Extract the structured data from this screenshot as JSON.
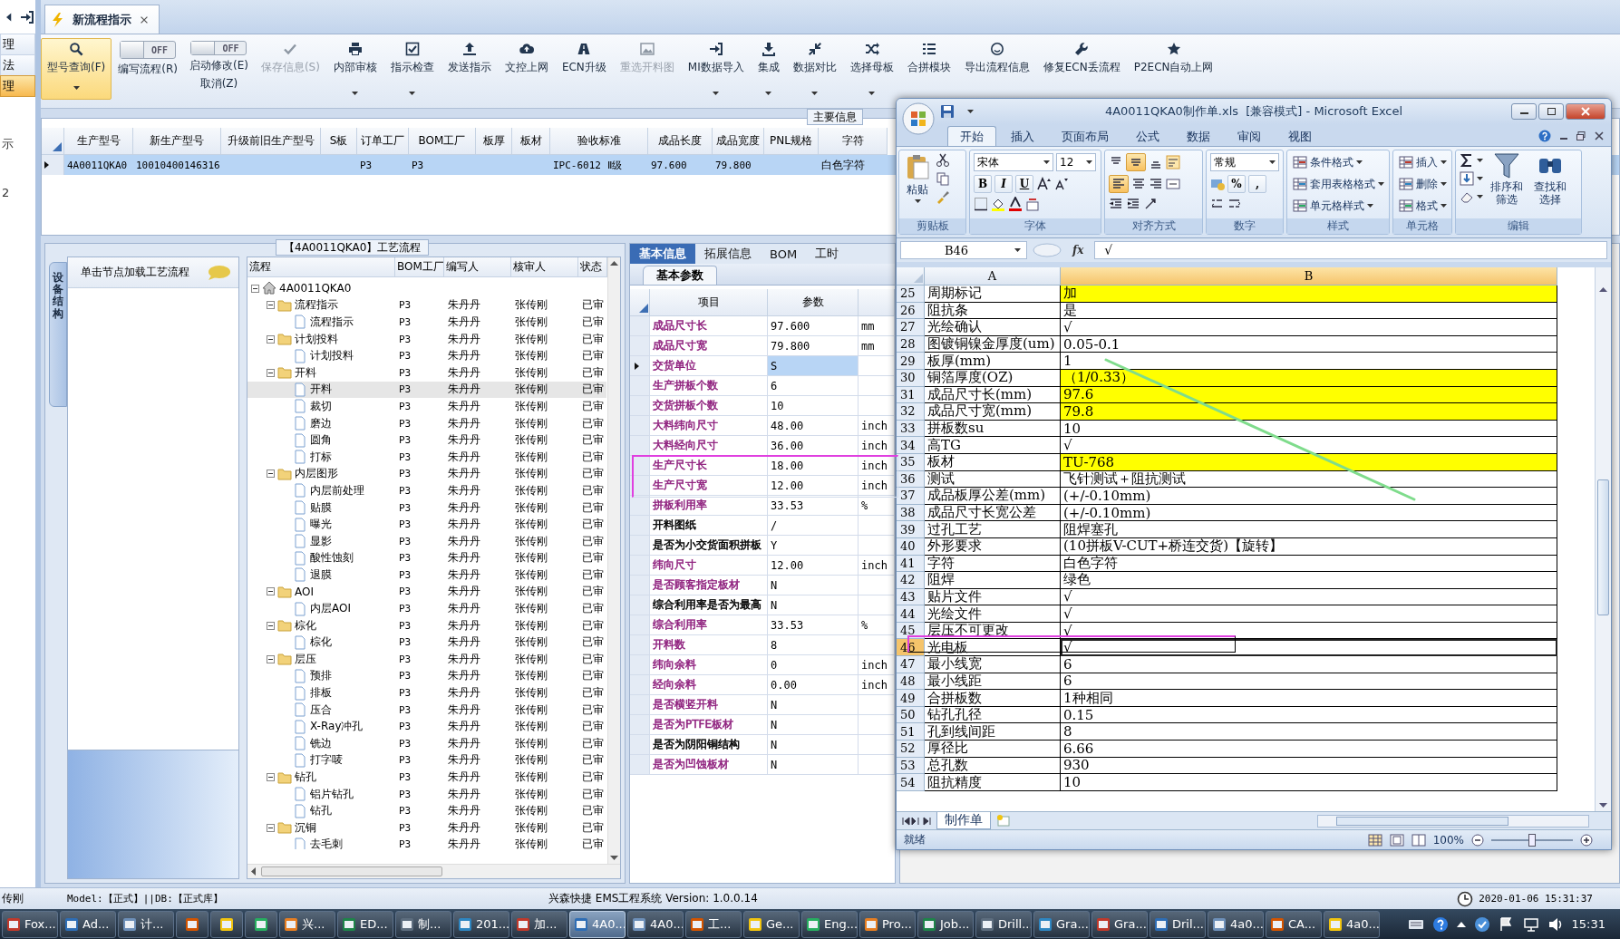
{
  "nav": {
    "items": [
      {
        "label": "理",
        "selected": false
      },
      {
        "label": "法",
        "selected": false
      },
      {
        "label": "理",
        "selected": true
      }
    ],
    "notes": [
      "示",
      "2"
    ]
  },
  "doc_tabs": [
    {
      "label": "新流程指示",
      "selected": true
    }
  ],
  "toolbar": {
    "items": [
      {
        "kind": "button",
        "label": "型号查询(F)",
        "active": true,
        "dropdown": true,
        "disabled": false
      },
      {
        "kind": "toggle",
        "label": "编写流程(R)",
        "switch_text": "OFF",
        "on": false
      },
      {
        "kind": "toggle",
        "label": "启动修改(E)",
        "sublabel": "取消(Z)",
        "switch_text": "OFF",
        "on": false
      },
      {
        "kind": "button",
        "label": "保存信息(S)",
        "active": false,
        "dropdown": false,
        "disabled": true
      },
      {
        "kind": "button",
        "label": "内部审核",
        "active": false,
        "dropdown": true,
        "disabled": false
      },
      {
        "kind": "button",
        "label": "指示检查",
        "active": false,
        "dropdown": true,
        "disabled": false
      },
      {
        "kind": "button",
        "label": "发送指示",
        "active": false,
        "dropdown": false,
        "disabled": false
      },
      {
        "kind": "button",
        "label": "文控上网",
        "active": false,
        "dropdown": false,
        "disabled": false
      },
      {
        "kind": "button",
        "label": "ECN升级",
        "active": false,
        "dropdown": false,
        "disabled": false
      },
      {
        "kind": "button",
        "label": "重选开料图",
        "active": false,
        "dropdown": false,
        "disabled": true
      },
      {
        "kind": "button",
        "label": "MI数据导入",
        "active": false,
        "dropdown": true,
        "disabled": false
      },
      {
        "kind": "button",
        "label": "集成",
        "active": false,
        "dropdown": true,
        "disabled": false
      },
      {
        "kind": "button",
        "label": "数据对比",
        "active": false,
        "dropdown": true,
        "disabled": false
      },
      {
        "kind": "button",
        "label": "选择母板",
        "active": false,
        "dropdown": true,
        "disabled": false
      },
      {
        "kind": "button",
        "label": "合拼模块",
        "active": false,
        "dropdown": false,
        "disabled": false
      },
      {
        "kind": "button",
        "label": "导出流程信息",
        "active": false,
        "dropdown": false,
        "disabled": false
      },
      {
        "kind": "button",
        "label": "修复ECN丢流程",
        "active": false,
        "dropdown": false,
        "disabled": false
      },
      {
        "kind": "button",
        "label": "P2ECN自动上网",
        "active": false,
        "dropdown": false,
        "disabled": false
      }
    ]
  },
  "info": {
    "title": "主要信息",
    "row_selected": true,
    "columns": [
      {
        "label": "生产型号",
        "value": "4A0011QKA0"
      },
      {
        "label": "新生产型号",
        "value": "10010400146316"
      },
      {
        "label": "升级前旧生产型号"
      },
      {
        "label": "S板"
      },
      {
        "label": "订单工厂",
        "value": "P3"
      },
      {
        "label": "BOM工厂",
        "value": "P3"
      },
      {
        "label": "板厚"
      },
      {
        "label": "板材"
      },
      {
        "label": "验收标准",
        "value": "IPC-6012 Ⅱ级"
      },
      {
        "label": "成品长度",
        "value": "97.600"
      },
      {
        "label": "成品宽度",
        "value": "79.800"
      },
      {
        "label": "PNL规格"
      },
      {
        "label": "字符",
        "value": "白色字符"
      }
    ]
  },
  "flow": {
    "title": "【4A0011QKA0】工艺流程",
    "side_tab": "设备结构",
    "hint": "单击节点加载工艺流程",
    "columns": [
      "流程",
      "BOM工厂",
      "编写人",
      "核审人",
      "状态"
    ],
    "root": {
      "label": "4A0011QKA0",
      "selected": false,
      "expanded": true,
      "children": [
        {
          "label": "流程指示",
          "bom": "P3",
          "writer": "朱丹丹",
          "reviewer": "张传刚",
          "status": "已审",
          "selected": false,
          "expanded": true,
          "children": [
            {
              "label": "流程指示",
              "bom": "P3",
              "writer": "朱丹丹",
              "reviewer": "张传刚",
              "status": "已审",
              "selected": false
            }
          ]
        },
        {
          "label": "计划投料",
          "bom": "P3",
          "writer": "朱丹丹",
          "reviewer": "张传刚",
          "status": "已审",
          "selected": false,
          "expanded": true,
          "children": [
            {
              "label": "计划投料",
              "bom": "P3",
              "writer": "朱丹丹",
              "reviewer": "张传刚",
              "status": "已审",
              "selected": false
            }
          ]
        },
        {
          "label": "开料",
          "bom": "P3",
          "writer": "朱丹丹",
          "reviewer": "张传刚",
          "status": "已审",
          "selected": false,
          "expanded": true,
          "children": [
            {
              "label": "开料",
              "bom": "P3",
              "writer": "朱丹丹",
              "reviewer": "张传刚",
              "status": "已审",
              "selected": true
            },
            {
              "label": "裁切",
              "bom": "P3",
              "writer": "朱丹丹",
              "reviewer": "张传刚",
              "status": "已审",
              "selected": false
            },
            {
              "label": "磨边",
              "bom": "P3",
              "writer": "朱丹丹",
              "reviewer": "张传刚",
              "status": "已审",
              "selected": false
            },
            {
              "label": "圆角",
              "bom": "P3",
              "writer": "朱丹丹",
              "reviewer": "张传刚",
              "status": "已审",
              "selected": false
            },
            {
              "label": "打标",
              "bom": "P3",
              "writer": "朱丹丹",
              "reviewer": "张传刚",
              "status": "已审",
              "selected": false
            }
          ]
        },
        {
          "label": "内层图形",
          "bom": "P3",
          "writer": "朱丹丹",
          "reviewer": "张传刚",
          "status": "已审",
          "selected": false,
          "expanded": true,
          "children": [
            {
              "label": "内层前处理",
              "bom": "P3",
              "writer": "朱丹丹",
              "reviewer": "张传刚",
              "status": "已审",
              "selected": false
            },
            {
              "label": "贴膜",
              "bom": "P3",
              "writer": "朱丹丹",
              "reviewer": "张传刚",
              "status": "已审",
              "selected": false
            },
            {
              "label": "曝光",
              "bom": "P3",
              "writer": "朱丹丹",
              "reviewer": "张传刚",
              "status": "已审",
              "selected": false
            },
            {
              "label": "显影",
              "bom": "P3",
              "writer": "朱丹丹",
              "reviewer": "张传刚",
              "status": "已审",
              "selected": false
            },
            {
              "label": "酸性蚀刻",
              "bom": "P3",
              "writer": "朱丹丹",
              "reviewer": "张传刚",
              "status": "已审",
              "selected": false
            },
            {
              "label": "退膜",
              "bom": "P3",
              "writer": "朱丹丹",
              "reviewer": "张传刚",
              "status": "已审",
              "selected": false
            }
          ]
        },
        {
          "label": "AOI",
          "bom": "P3",
          "writer": "朱丹丹",
          "reviewer": "张传刚",
          "status": "已审",
          "selected": false,
          "expanded": true,
          "children": [
            {
              "label": "内层AOI",
              "bom": "P3",
              "writer": "朱丹丹",
              "reviewer": "张传刚",
              "status": "已审",
              "selected": false
            }
          ]
        },
        {
          "label": "棕化",
          "bom": "P3",
          "writer": "朱丹丹",
          "reviewer": "张传刚",
          "status": "已审",
          "selected": false,
          "expanded": true,
          "children": [
            {
              "label": "棕化",
              "bom": "P3",
              "writer": "朱丹丹",
              "reviewer": "张传刚",
              "status": "已审",
              "selected": false
            }
          ]
        },
        {
          "label": "层压",
          "bom": "P3",
          "writer": "朱丹丹",
          "reviewer": "张传刚",
          "status": "已审",
          "selected": false,
          "expanded": true,
          "children": [
            {
              "label": "预排",
              "bom": "P3",
              "writer": "朱丹丹",
              "reviewer": "张传刚",
              "status": "已审",
              "selected": false
            },
            {
              "label": "排板",
              "bom": "P3",
              "writer": "朱丹丹",
              "reviewer": "张传刚",
              "status": "已审",
              "selected": false
            },
            {
              "label": "压合",
              "bom": "P3",
              "writer": "朱丹丹",
              "reviewer": "张传刚",
              "status": "已审",
              "selected": false
            },
            {
              "label": "X-Ray冲孔",
              "bom": "P3",
              "writer": "朱丹丹",
              "reviewer": "张传刚",
              "status": "已审",
              "selected": false
            },
            {
              "label": "铣边",
              "bom": "P3",
              "writer": "朱丹丹",
              "reviewer": "张传刚",
              "status": "已审",
              "selected": false
            },
            {
              "label": "打字唛",
              "bom": "P3",
              "writer": "朱丹丹",
              "reviewer": "张传刚",
              "status": "已审",
              "selected": false
            }
          ]
        },
        {
          "label": "钻孔",
          "bom": "P3",
          "writer": "朱丹丹",
          "reviewer": "张传刚",
          "status": "已审",
          "selected": false,
          "expanded": true,
          "children": [
            {
              "label": "铝片钻孔",
              "bom": "P3",
              "writer": "朱丹丹",
              "reviewer": "张传刚",
              "status": "已审",
              "selected": false
            },
            {
              "label": "钻孔",
              "bom": "P3",
              "writer": "朱丹丹",
              "reviewer": "张传刚",
              "status": "已审",
              "selected": false
            }
          ]
        },
        {
          "label": "沉铜",
          "bom": "P3",
          "writer": "朱丹丹",
          "reviewer": "张传刚",
          "status": "已审",
          "selected": false,
          "expanded": true,
          "children": [
            {
              "label": "去毛刺",
              "bom": "P3",
              "writer": "朱丹丹",
              "reviewer": "张传刚",
              "status": "已审",
              "selected": false
            }
          ]
        }
      ]
    }
  },
  "params": {
    "tabs": [
      {
        "label": "基本信息",
        "selected": true
      },
      {
        "label": "拓展信息",
        "selected": false
      },
      {
        "label": "BOM",
        "selected": false
      },
      {
        "label": "工时",
        "selected": false
      }
    ],
    "subtab": "基本参数",
    "columns": [
      "项目",
      "参数"
    ],
    "rows": [
      {
        "name": "成品尺寸长",
        "value": "97.600",
        "unit": "mm",
        "color": "#8e1f7d",
        "selected": false,
        "outlined": false
      },
      {
        "name": "成品尺寸宽",
        "value": "79.800",
        "unit": "mm",
        "color": "#8e1f7d",
        "selected": false,
        "outlined": false
      },
      {
        "name": "交货单位",
        "value": "S",
        "color": "#8e1f7d",
        "selected": true,
        "outlined": false
      },
      {
        "name": "生产拼板个数",
        "value": "6",
        "color": "#8e1f7d",
        "selected": false,
        "outlined": false
      },
      {
        "name": "交货拼板个数",
        "value": "10",
        "color": "#8e1f7d",
        "selected": false,
        "outlined": false
      },
      {
        "name": "大料纬向尺寸",
        "value": "48.00",
        "unit": "inch",
        "color": "#8e1f7d",
        "selected": false,
        "outlined": false
      },
      {
        "name": "大料经向尺寸",
        "value": "36.00",
        "unit": "inch",
        "color": "#8e1f7d",
        "selected": false,
        "outlined": false
      },
      {
        "name": "生产尺寸长",
        "value": "18.00",
        "unit": "inch",
        "color": "#8e1f7d",
        "selected": false,
        "outlined": true
      },
      {
        "name": "生产尺寸宽",
        "value": "12.00",
        "unit": "inch",
        "color": "#8e1f7d",
        "selected": false,
        "outlined": true
      },
      {
        "name": "拼板利用率",
        "value": "33.53",
        "unit": "%",
        "color": "#8e1f7d",
        "selected": false,
        "outlined": false
      },
      {
        "name": "开料图纸",
        "value": "/",
        "color": "#000000",
        "selected": false,
        "outlined": false
      },
      {
        "name": "是否为小交货面积拼板",
        "value": "Y",
        "color": "#000000",
        "selected": false,
        "outlined": false
      },
      {
        "name": "纬向尺寸",
        "value": "12.00",
        "unit": "inch",
        "color": "#8e1f7d",
        "selected": false,
        "outlined": false
      },
      {
        "name": "是否顾客指定板材",
        "value": "N",
        "color": "#8e1f7d",
        "selected": false,
        "outlined": false
      },
      {
        "name": "综合利用率是否为最高",
        "value": "N",
        "color": "#000000",
        "selected": false,
        "outlined": false
      },
      {
        "name": "综合利用率",
        "value": "33.53",
        "unit": "%",
        "color": "#8e1f7d",
        "selected": false,
        "outlined": false
      },
      {
        "name": "开料数",
        "value": "8",
        "color": "#8e1f7d",
        "selected": false,
        "outlined": false
      },
      {
        "name": "纬向余料",
        "value": "0",
        "unit": "inch",
        "color": "#8e1f7d",
        "selected": false,
        "outlined": false
      },
      {
        "name": "经向余料",
        "value": "0.00",
        "unit": "inch",
        "color": "#8e1f7d",
        "selected": false,
        "outlined": false
      },
      {
        "name": "是否横竖开料",
        "value": "N",
        "color": "#8e1f7d",
        "selected": false,
        "outlined": false
      },
      {
        "name": "是否为PTFE板材",
        "value": "N",
        "color": "#8e1f7d",
        "selected": false,
        "outlined": false
      },
      {
        "name": "是否为阴阳铜结构",
        "value": "N",
        "color": "#000000",
        "selected": false,
        "outlined": false
      },
      {
        "name": "是否为凹蚀板材",
        "value": "N",
        "color": "#8e1f7d",
        "selected": false,
        "outlined": false
      }
    ]
  },
  "status": {
    "user": "传刚",
    "model": "Model:【正式】||DB:【正式库】",
    "app": "兴森快捷 EMS工程系统 Version: 1.0.0.14",
    "datetime": "2020-01-06 15:31:37"
  },
  "taskbar": {
    "clock": "15:31",
    "items": [
      {
        "kind": "app",
        "label": "Fox...",
        "active": false
      },
      {
        "kind": "app",
        "label": "Ad...",
        "active": false
      },
      {
        "kind": "app",
        "label": "计...",
        "active": false
      },
      {
        "kind": "icon",
        "active": false
      },
      {
        "kind": "icon",
        "active": false
      },
      {
        "kind": "icon",
        "active": false
      },
      {
        "kind": "app",
        "label": "兴...",
        "active": false
      },
      {
        "kind": "app",
        "label": "ED...",
        "active": false
      },
      {
        "kind": "app",
        "label": "制...",
        "active": false
      },
      {
        "kind": "app",
        "label": "201...",
        "active": false
      },
      {
        "kind": "app",
        "label": "加...",
        "active": false
      },
      {
        "kind": "app",
        "label": "4A0...",
        "active": true
      },
      {
        "kind": "app",
        "label": "4A0...",
        "active": false
      },
      {
        "kind": "app",
        "label": "工...",
        "active": false
      },
      {
        "kind": "app",
        "label": "Ge...",
        "active": false
      },
      {
        "kind": "app",
        "label": "Eng...",
        "active": false
      },
      {
        "kind": "app",
        "label": "Pro...",
        "active": false
      },
      {
        "kind": "app",
        "label": "Job...",
        "active": false
      },
      {
        "kind": "app",
        "label": "Drill...",
        "active": false
      },
      {
        "kind": "app",
        "label": "Gra...",
        "active": false
      },
      {
        "kind": "app",
        "label": "Gra...",
        "active": false
      },
      {
        "kind": "app",
        "label": "Dril...",
        "active": false
      },
      {
        "kind": "app",
        "label": "4a0...",
        "active": false
      },
      {
        "kind": "app",
        "label": "CA...",
        "active": false
      },
      {
        "kind": "app",
        "label": "4a0...",
        "active": false
      }
    ]
  },
  "excel": {
    "title": "4A0011QKA0制作单.xls  [兼容模式] - Microsoft Excel",
    "tabs": [
      {
        "label": "开始",
        "selected": true
      },
      {
        "label": "插入",
        "selected": false
      },
      {
        "label": "页面布局",
        "selected": false
      },
      {
        "label": "公式",
        "selected": false
      },
      {
        "label": "数据",
        "selected": false
      },
      {
        "label": "审阅",
        "selected": false
      },
      {
        "label": "视图",
        "selected": false
      }
    ],
    "ribbon": [
      {
        "kind": "clipboard",
        "label": "剪贴板",
        "paste": "粘贴"
      },
      {
        "kind": "font",
        "label": "字体",
        "font": "宋体",
        "size": "12",
        "styles": [
          "B",
          "I",
          "U"
        ]
      },
      {
        "kind": "align",
        "label": "对齐方式"
      },
      {
        "kind": "number",
        "label": "数字",
        "format": "常规",
        "symbols": [
          "%",
          ","
        ]
      },
      {
        "kind": "commands",
        "label": "样式",
        "commands": [
          "条件格式",
          "套用表格格式",
          "单元格样式"
        ]
      },
      {
        "kind": "commands",
        "label": "单元格",
        "commands": [
          "插入",
          "删除",
          "格式"
        ]
      },
      {
        "kind": "edit",
        "label": "编辑",
        "commands": [
          "排序和筛选",
          "查找和选择"
        ]
      }
    ],
    "name_box": "B46",
    "function_label": "fx",
    "formula": "√",
    "columns": [
      {
        "label": "A",
        "selected": false
      },
      {
        "label": "B",
        "selected": true
      }
    ],
    "rows": [
      {
        "row": "25",
        "a": "周期标记",
        "b": "加",
        "color": "#ffff00",
        "selected": false,
        "outlined": false
      },
      {
        "row": "26",
        "a": "阻抗条",
        "b": "是",
        "color": "#ffffff",
        "selected": false,
        "outlined": false
      },
      {
        "row": "27",
        "a": "光绘确认",
        "b": "√",
        "color": "#ffffff",
        "selected": false,
        "outlined": false
      },
      {
        "row": "28",
        "a": "图镀铜镍金厚度(um)",
        "b": "0.05-0.1",
        "color": "#ffffff",
        "selected": false,
        "outlined": false
      },
      {
        "row": "29",
        "a": "板厚(mm)",
        "b": "1",
        "color": "#ffffff",
        "selected": false,
        "outlined": false
      },
      {
        "row": "30",
        "a": "铜箔厚度(OZ)",
        "b": "（1/0.33）",
        "color": "#ffff00",
        "selected": false,
        "outlined": false
      },
      {
        "row": "31",
        "a": "成品尺寸长(mm)",
        "b": "97.6",
        "color": "#ffff00",
        "selected": false,
        "outlined": false
      },
      {
        "row": "32",
        "a": "成品尺寸宽(mm)",
        "b": "79.8",
        "color": "#ffff00",
        "selected": false,
        "outlined": false
      },
      {
        "row": "33",
        "a": "拼板数su",
        "b": "10",
        "color": "#ffffff",
        "selected": false,
        "outlined": false
      },
      {
        "row": "34",
        "a": "高TG",
        "b": "√",
        "color": "#ffffff",
        "selected": false,
        "outlined": false
      },
      {
        "row": "35",
        "a": "板材",
        "b": "TU-768",
        "color": "#ffff00",
        "selected": false,
        "outlined": false
      },
      {
        "row": "36",
        "a": "测试",
        "b": "飞针测试＋阻抗测试",
        "color": "#ffffff",
        "selected": false,
        "outlined": false
      },
      {
        "row": "37",
        "a": "成品板厚公差(mm)",
        "b": "(+/-0.10mm)",
        "color": "#ffffff",
        "selected": false,
        "outlined": false
      },
      {
        "row": "38",
        "a": "成品尺寸长宽公差",
        "b": "(+/-0.10mm)",
        "color": "#ffffff",
        "selected": false,
        "outlined": false
      },
      {
        "row": "39",
        "a": "过孔工艺",
        "b": "阻焊塞孔",
        "color": "#ffffff",
        "selected": false,
        "outlined": false
      },
      {
        "row": "40",
        "a": "外形要求",
        "b": "(10拼板V-CUT+桥连交货)【旋转】",
        "color": "#ffffff",
        "selected": false,
        "outlined": false
      },
      {
        "row": "41",
        "a": "字符",
        "b": "白色字符",
        "color": "#ffffff",
        "selected": false,
        "outlined": false
      },
      {
        "row": "42",
        "a": "阻焊",
        "b": "绿色",
        "color": "#ffffff",
        "selected": false,
        "outlined": false
      },
      {
        "row": "43",
        "a": "贴片文件",
        "b": "√",
        "color": "#ffffff",
        "selected": false,
        "outlined": false
      },
      {
        "row": "44",
        "a": "光绘文件",
        "b": "√",
        "color": "#ffffff",
        "selected": false,
        "outlined": false
      },
      {
        "row": "45",
        "a": "层压不可更改",
        "b": "√",
        "color": "#ffffff",
        "selected": false,
        "outlined": false
      },
      {
        "row": "46",
        "a": "光电板",
        "b": "√",
        "color": "#ffffff",
        "selected": true,
        "outlined": true
      },
      {
        "row": "47",
        "a": "最小线宽",
        "b": "6",
        "color": "#ffffff",
        "selected": false,
        "outlined": false
      },
      {
        "row": "48",
        "a": "最小线距",
        "b": "6",
        "color": "#ffffff",
        "selected": false,
        "outlined": false
      },
      {
        "row": "49",
        "a": "合拼板数",
        "b": "1种相同",
        "color": "#ffffff",
        "selected": false,
        "outlined": false
      },
      {
        "row": "50",
        "a": "钻孔孔径",
        "b": "0.15",
        "color": "#ffffff",
        "selected": false,
        "outlined": false
      },
      {
        "row": "51",
        "a": "孔到线间距",
        "b": "8",
        "color": "#ffffff",
        "selected": false,
        "outlined": false
      },
      {
        "row": "52",
        "a": "厚径比",
        "b": "6.66",
        "color": "#ffffff",
        "selected": false,
        "outlined": false
      },
      {
        "row": "53",
        "a": "总孔数",
        "b": "930",
        "color": "#ffffff",
        "selected": false,
        "outlined": false
      },
      {
        "row": "54",
        "a": "阻抗精度",
        "b": "10",
        "color": "#ffffff",
        "selected": false,
        "outlined": false
      }
    ],
    "sheets": [
      {
        "label": "制作单",
        "selected": true
      }
    ],
    "status": "就绪",
    "zoom": "100%",
    "zoom_slider": {
      "level": 0.5
    }
  }
}
